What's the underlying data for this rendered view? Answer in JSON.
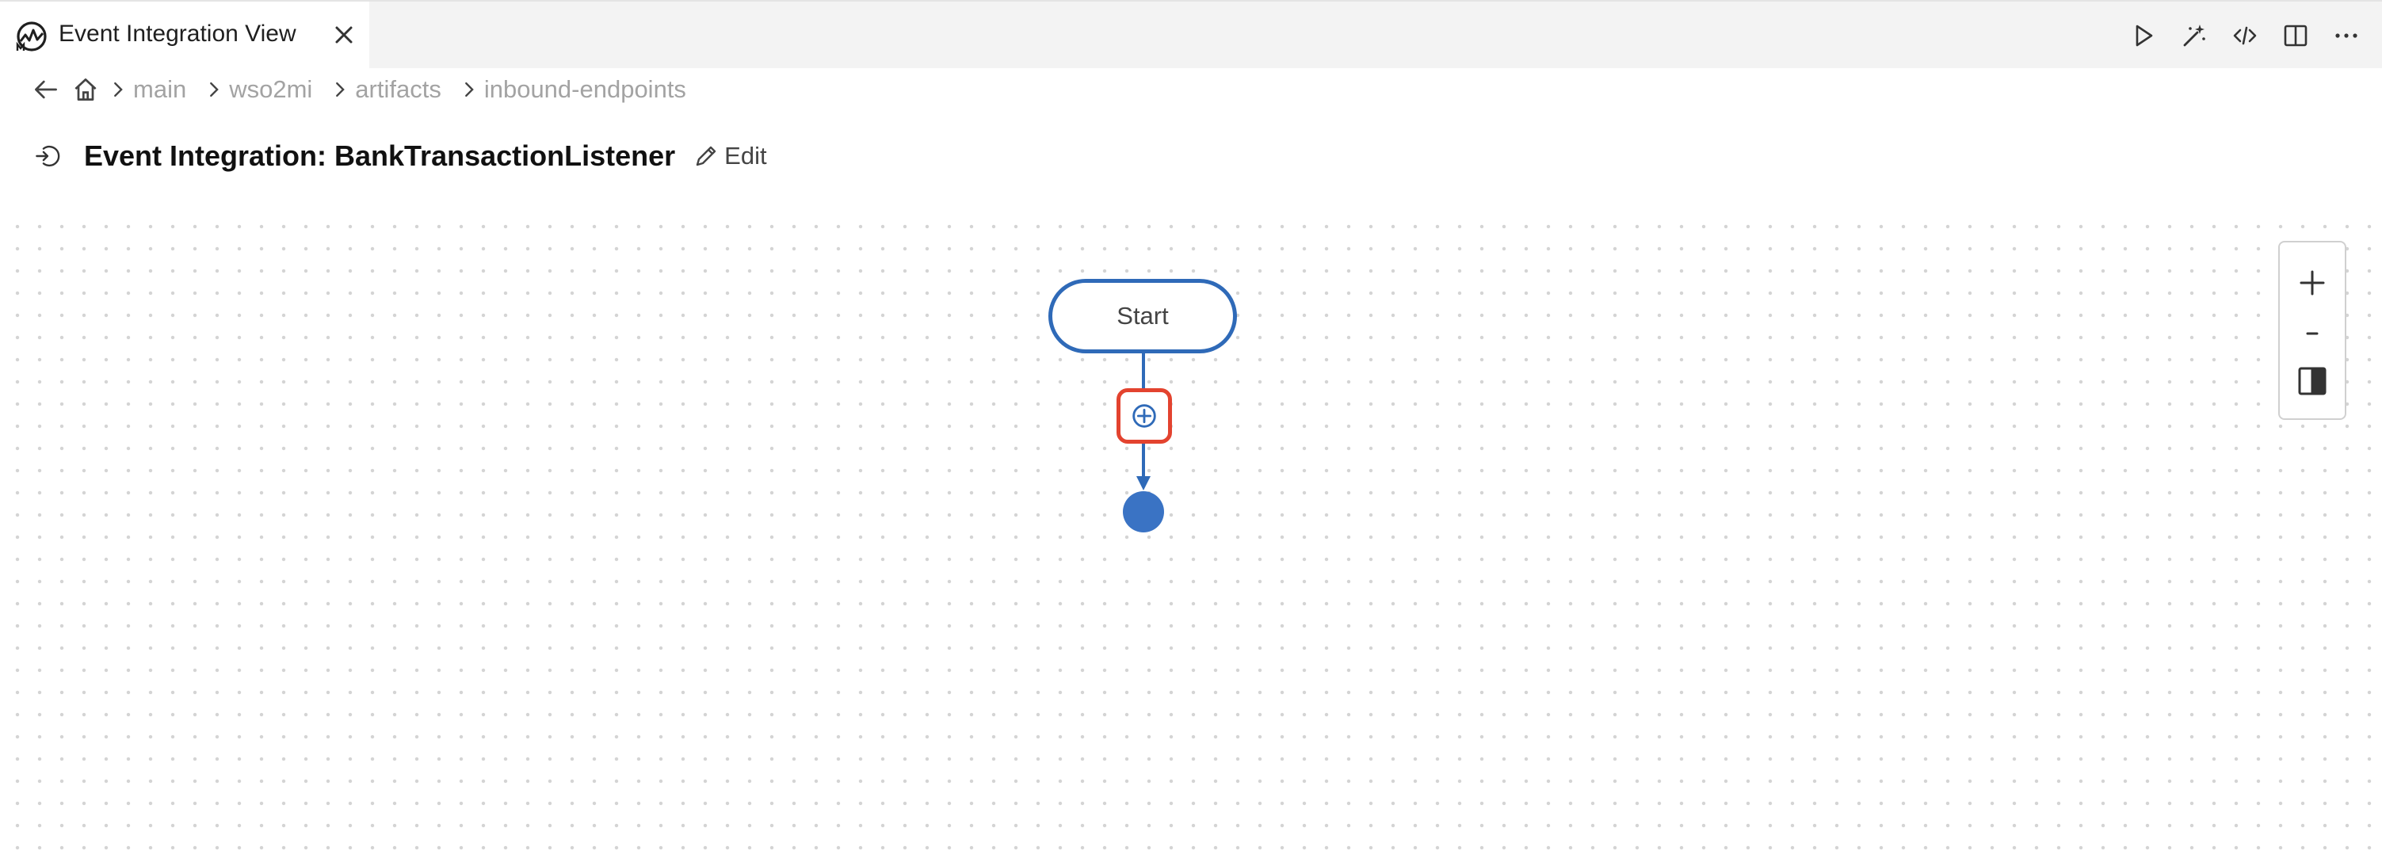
{
  "tab": {
    "title": "Event Integration View",
    "icon": "mi-logo-icon"
  },
  "header_actions": [
    {
      "name": "run-icon"
    },
    {
      "name": "magic-wand-icon"
    },
    {
      "name": "code-icon"
    },
    {
      "name": "split-editor-icon"
    },
    {
      "name": "more-icon"
    }
  ],
  "breadcrumb": {
    "items": [
      "main",
      "wso2mi",
      "artifacts",
      "inbound-endpoints"
    ]
  },
  "page": {
    "title": "Event Integration: BankTransactionListener",
    "edit_label": "Edit"
  },
  "diagram": {
    "start_label": "Start"
  },
  "colors": {
    "flow_blue": "#2f6ab8",
    "end_node": "#3a73c4",
    "highlight_red": "#e3432f",
    "tab_bar": "#f3f3f3"
  }
}
